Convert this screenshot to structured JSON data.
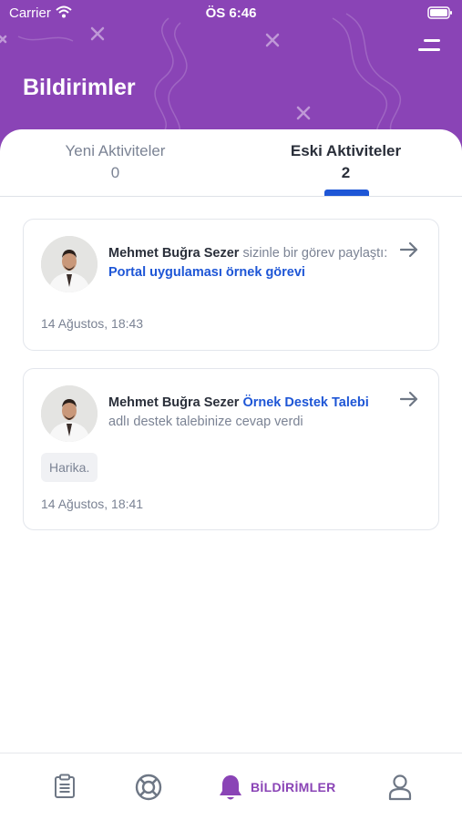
{
  "status_bar": {
    "carrier": "Carrier",
    "time": "ÖS 6:46"
  },
  "header": {
    "title": "Bildirimler",
    "background_color": "#8a44b6",
    "menu_icon": "menu-lines-icon"
  },
  "tabs": [
    {
      "label": "Yeni Aktiviteler",
      "count": "0",
      "active": false
    },
    {
      "label": "Eski Aktiviteler",
      "count": "2",
      "active": true
    }
  ],
  "accent_color": "#1e56d6",
  "notifications": [
    {
      "user": "Mehmet Buğra Sezer",
      "text_before": " sizinle bir görev paylaştı: ",
      "link": "Portal uygulaması örnek görevi",
      "text_after": "",
      "reply": "",
      "time": "14 Ağustos, 18:43"
    },
    {
      "user": "Mehmet Buğra Sezer",
      "text_before": " ",
      "link": "Örnek Destek Talebi",
      "text_after": " adlı destek talebinize cevap verdi",
      "reply": "Harika.",
      "time": "14 Ağustos, 18:41"
    }
  ],
  "bottom_nav": {
    "items": [
      {
        "icon": "clipboard-icon",
        "label": ""
      },
      {
        "icon": "lifebuoy-icon",
        "label": ""
      },
      {
        "icon": "bell-icon",
        "label": "BİLDİRİMLER",
        "active": true
      },
      {
        "icon": "user-icon",
        "label": ""
      }
    ]
  }
}
